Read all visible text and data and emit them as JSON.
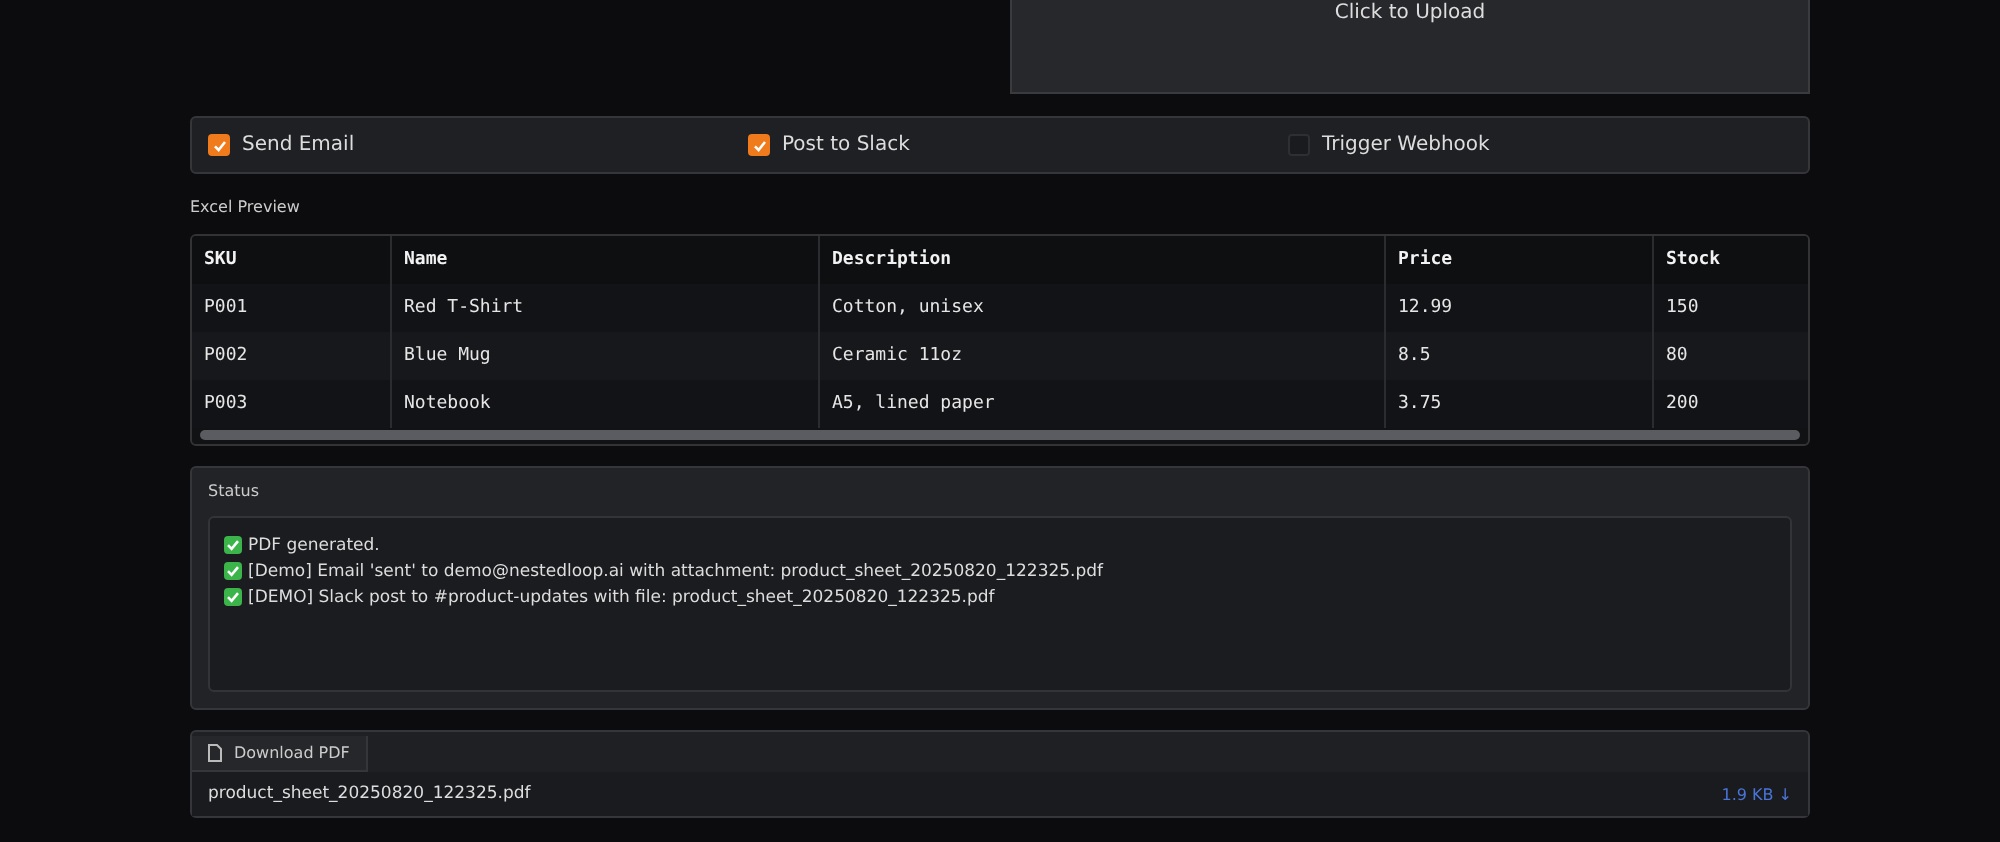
{
  "upload": {
    "label": "Click to Upload"
  },
  "options": [
    {
      "label": "Send Email",
      "checked": true
    },
    {
      "label": "Post to Slack",
      "checked": true
    },
    {
      "label": "Trigger Webhook",
      "checked": false
    }
  ],
  "preview": {
    "title": "Excel Preview",
    "columns": [
      "SKU",
      "Name",
      "Description",
      "Price",
      "Stock"
    ],
    "rows": [
      [
        "P001",
        "Red T-Shirt",
        "Cotton, unisex",
        "12.99",
        "150"
      ],
      [
        "P002",
        "Blue Mug",
        "Ceramic 11oz",
        "8.5",
        "80"
      ],
      [
        "P003",
        "Notebook",
        "A5, lined paper",
        "3.75",
        "200"
      ]
    ]
  },
  "status": {
    "title": "Status",
    "lines": [
      "PDF generated.",
      "[Demo] Email 'sent' to demo@nestedloop.ai with attachment: product_sheet_20250820_122325.pdf",
      "[DEMO] Slack post to #product-updates with file: product_sheet_20250820_122325.pdf"
    ]
  },
  "download": {
    "label": "Download PDF",
    "file": "product_sheet_20250820_122325.pdf",
    "size": "1.9 KB ↓"
  }
}
